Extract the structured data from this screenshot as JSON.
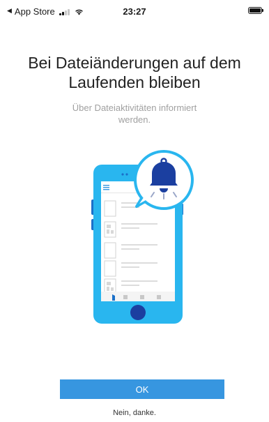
{
  "status_bar": {
    "back_label": "App Store",
    "time": "23:27"
  },
  "onboarding": {
    "title": "Bei Dateiänderungen auf dem Laufenden bleiben",
    "subtitle": "Über Dateiaktivitäten informiert werden.",
    "illustration_icon": "phone-notification-bell-icon"
  },
  "actions": {
    "ok_label": "OK",
    "dismiss_label": "Nein, danke."
  },
  "colors": {
    "accent": "#3796e0",
    "phone_body": "#29b6ef",
    "bell": "#1b3fa0"
  }
}
